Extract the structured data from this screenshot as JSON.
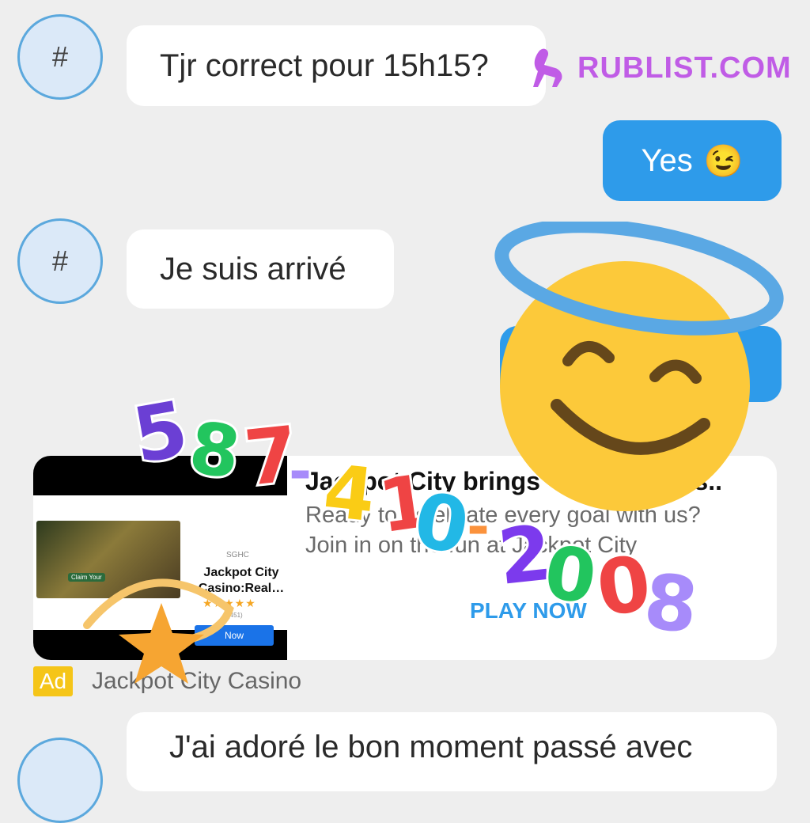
{
  "messages": [
    {
      "avatar": "#",
      "text": "Tjr correct pour 15h15?",
      "direction": "in"
    },
    {
      "text": "Yes",
      "emoji": "😉",
      "direction": "out"
    },
    {
      "avatar": "#",
      "text": "Je suis arrivé",
      "direction": "in"
    },
    {
      "avatar": "#",
      "text": "J'ai adoré le bon moment passé avec",
      "direction": "in"
    }
  ],
  "watermark": {
    "text": "RUBLIST.COM",
    "color": "#c05ce6"
  },
  "ad": {
    "thumbnail": {
      "publisher": "SGHC",
      "app_title": "Jackpot City Casino:Real…",
      "stars": "★★★★★",
      "review_count": "(451)",
      "install_label": "Now",
      "game_claim": "Claim Your"
    },
    "headline": "Jackpot City brings",
    "headline_suffix": "s s..",
    "body_line1": "Ready to celebrate every goal with us?",
    "body_line2": "Join in on the fun at Jackpot City",
    "cta": "PLAY NOW",
    "badge": "Ad",
    "advertiser": "Jackpot City Casino"
  },
  "sticker_phone": "587-410-2008",
  "colors": {
    "accent": "#2e9bea",
    "bubble_in": "#ffffff",
    "background": "#eeeeee",
    "ad_badge": "#f5c518"
  },
  "icons": {
    "angel": "smiling-face-with-halo-icon",
    "star": "star-icon"
  }
}
